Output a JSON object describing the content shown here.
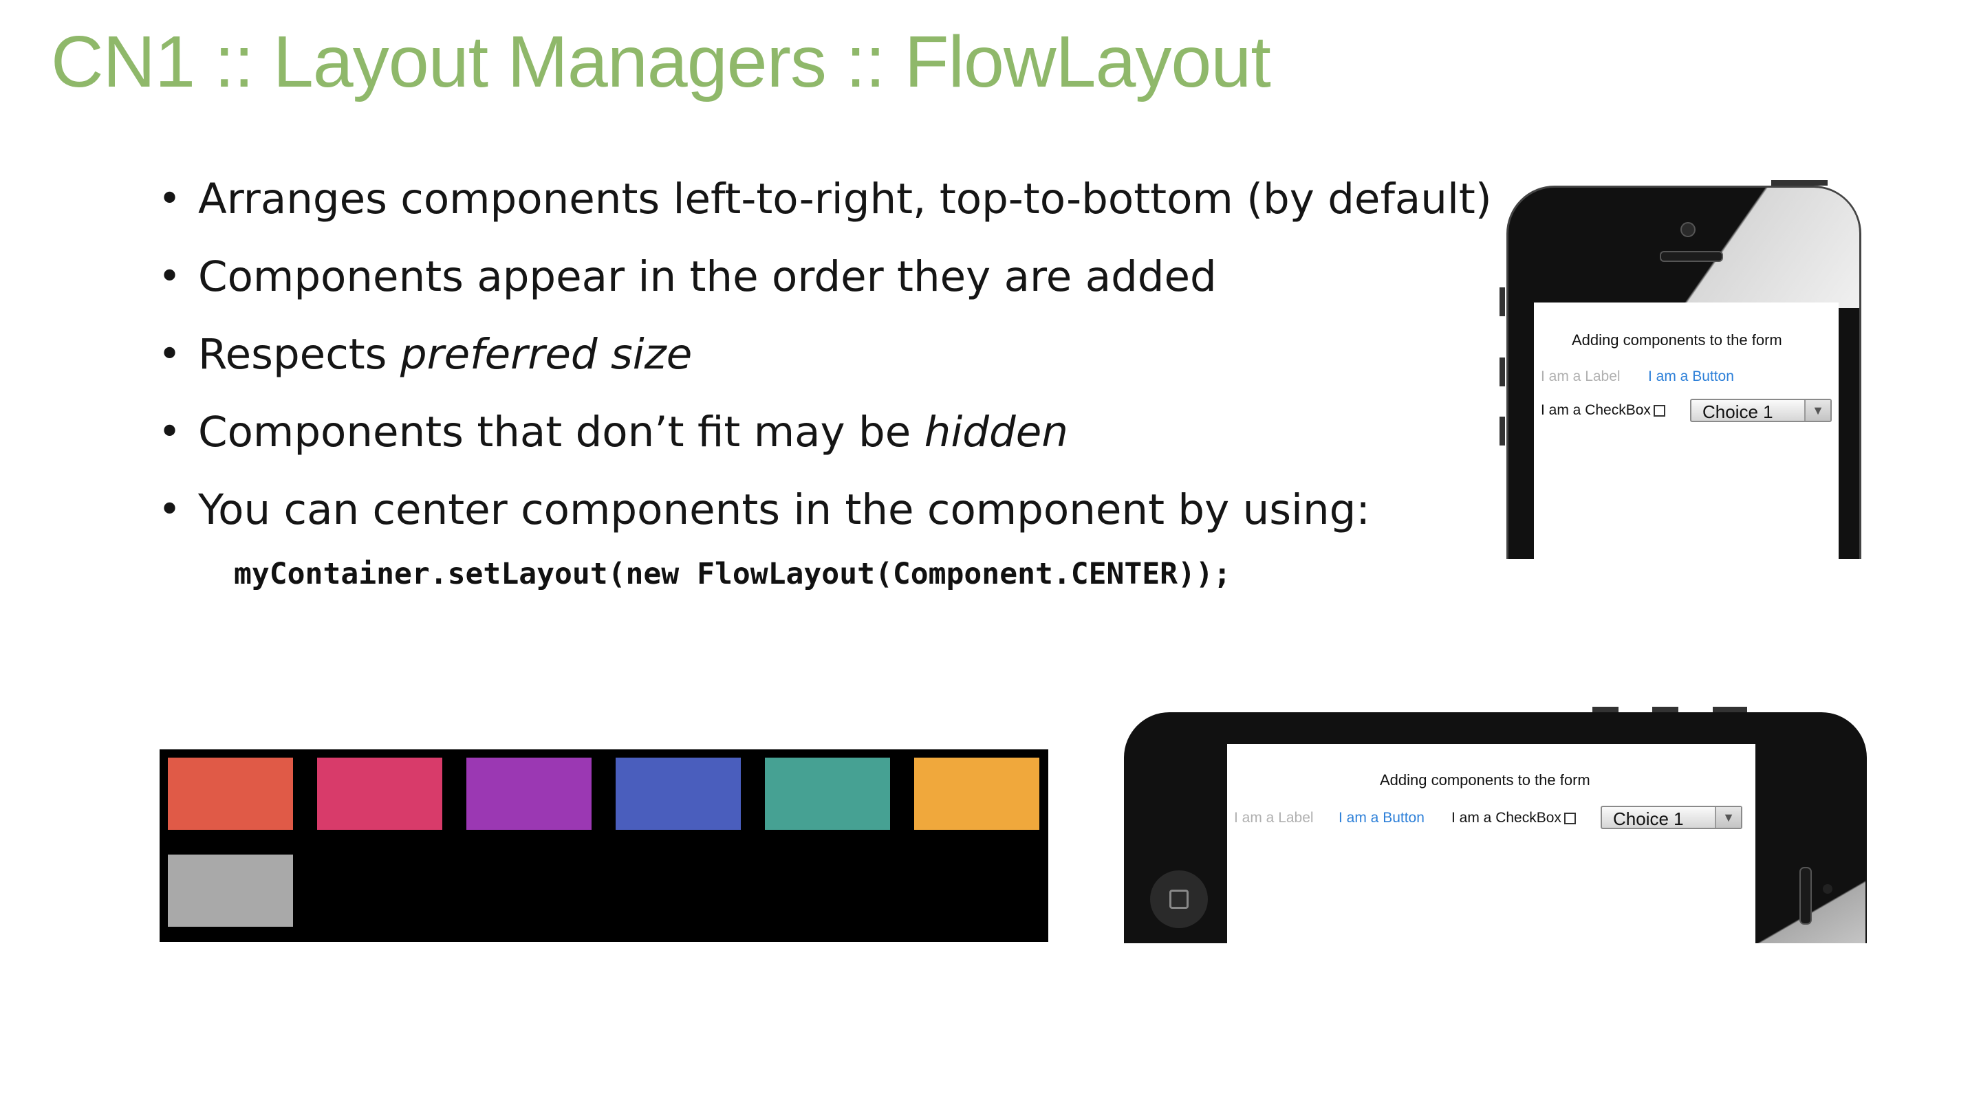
{
  "slide": {
    "title": "CN1 :: Layout Managers :: FlowLayout",
    "bullets": [
      {
        "before": "Arranges components left-to-right, top-to-bottom (by default)",
        "em": "",
        "after": ""
      },
      {
        "before": "Components appear in the order they are added",
        "em": "",
        "after": ""
      },
      {
        "before": "Respects ",
        "em": "preferred size",
        "after": ""
      },
      {
        "before": "Components that don’t fit may be ",
        "em": "hidden",
        "after": ""
      },
      {
        "before": "You can center components in the component by using:",
        "em": "",
        "after": ""
      }
    ],
    "code": "myContainer.setLayout(new FlowLayout(Component.CENTER));"
  },
  "flow_demo": {
    "colors": [
      "#e05a47",
      "#d83b6a",
      "#9b38b3",
      "#4a5ebd",
      "#46a193",
      "#f0a83c",
      "#a9a9a9"
    ]
  },
  "form": {
    "title": "Adding components to the form",
    "label": "I am a Label",
    "button": "I am a Button",
    "checkbox": "I am a CheckBox",
    "choice": "Choice 1"
  }
}
